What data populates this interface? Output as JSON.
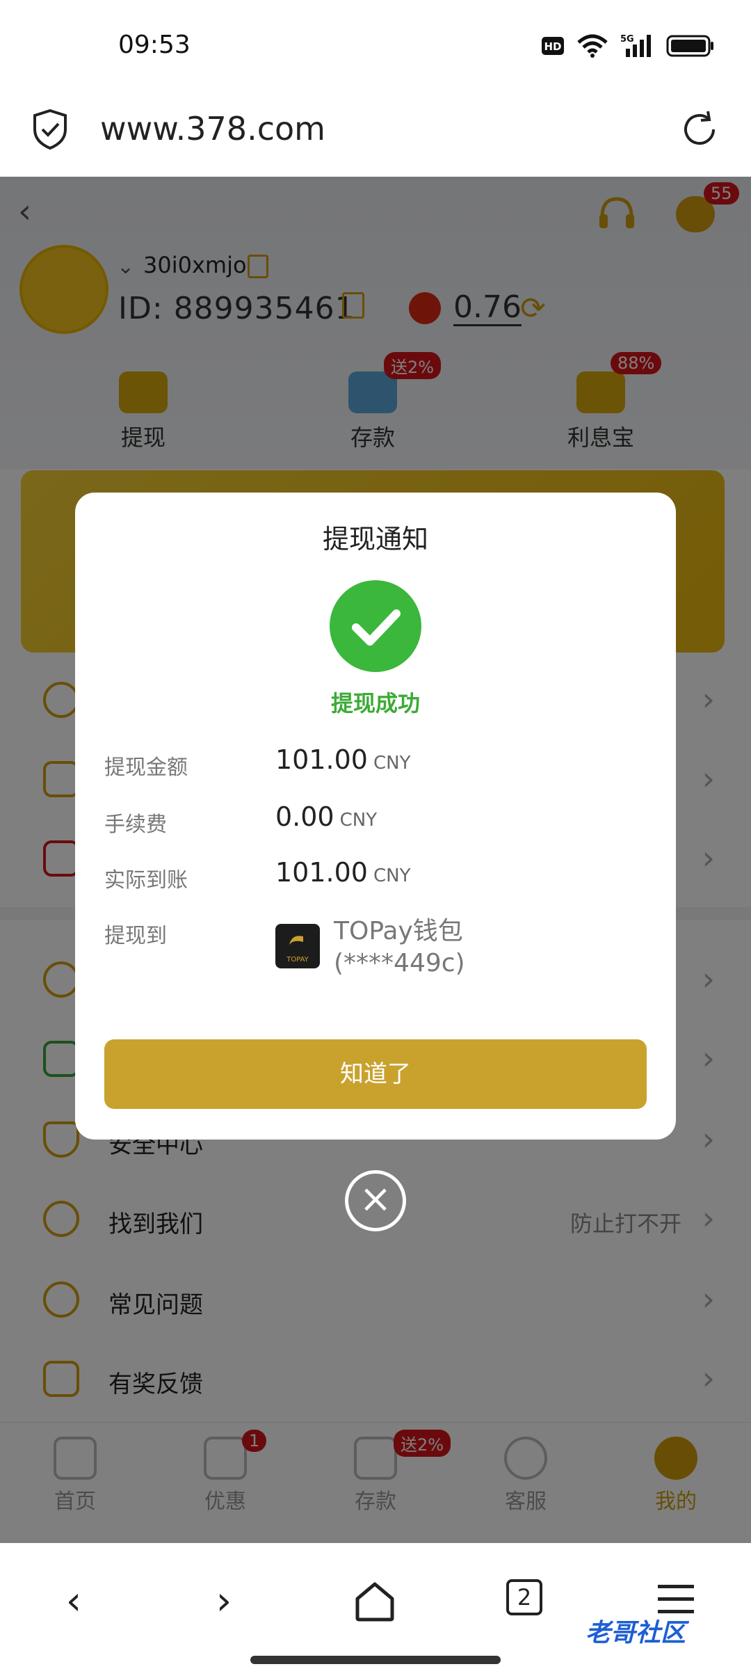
{
  "status_bar": {
    "time": "09:53",
    "icons": [
      "hd-icon",
      "wifi-icon",
      "5g-signal-icon",
      "battery-icon"
    ]
  },
  "browser": {
    "url": "www.378.com",
    "tab_count": "2"
  },
  "header": {
    "username": "30i0xmjo",
    "id_label": "ID:",
    "id_value": "889935461",
    "balance": "0.76",
    "message_badge": "55"
  },
  "quick_actions": [
    {
      "label": "提现",
      "badge": ""
    },
    {
      "label": "存款",
      "badge": "送2%"
    },
    {
      "label": "利息宝",
      "badge": "88%"
    }
  ],
  "menu": {
    "security": "安全中心",
    "find_us": "找到我们",
    "find_us_extra": "防止打不开",
    "faq": "常见问题",
    "feedback": "有奖反馈"
  },
  "tabs": [
    {
      "label": "首页",
      "badge": ""
    },
    {
      "label": "优惠",
      "badge": "1"
    },
    {
      "label": "存款",
      "badge": "送2%"
    },
    {
      "label": "客服",
      "badge": ""
    },
    {
      "label": "我的",
      "badge": ""
    }
  ],
  "modal": {
    "title": "提现通知",
    "status": "提现成功",
    "amount_label": "提现金额",
    "amount_value": "101.00",
    "fee_label": "手续费",
    "fee_value": "0.00",
    "actual_label": "实际到账",
    "actual_value": "101.00",
    "currency": "CNY",
    "to_label": "提现到",
    "wallet_name": "TOPay钱包",
    "wallet_account": "(****449c)",
    "wallet_logo_text": "TOPAY",
    "ok_button": "知道了"
  },
  "watermark": "老哥社区",
  "colors": {
    "accent": "#c9a22e",
    "success": "#3bb73b",
    "badge_red": "#d6141a"
  }
}
